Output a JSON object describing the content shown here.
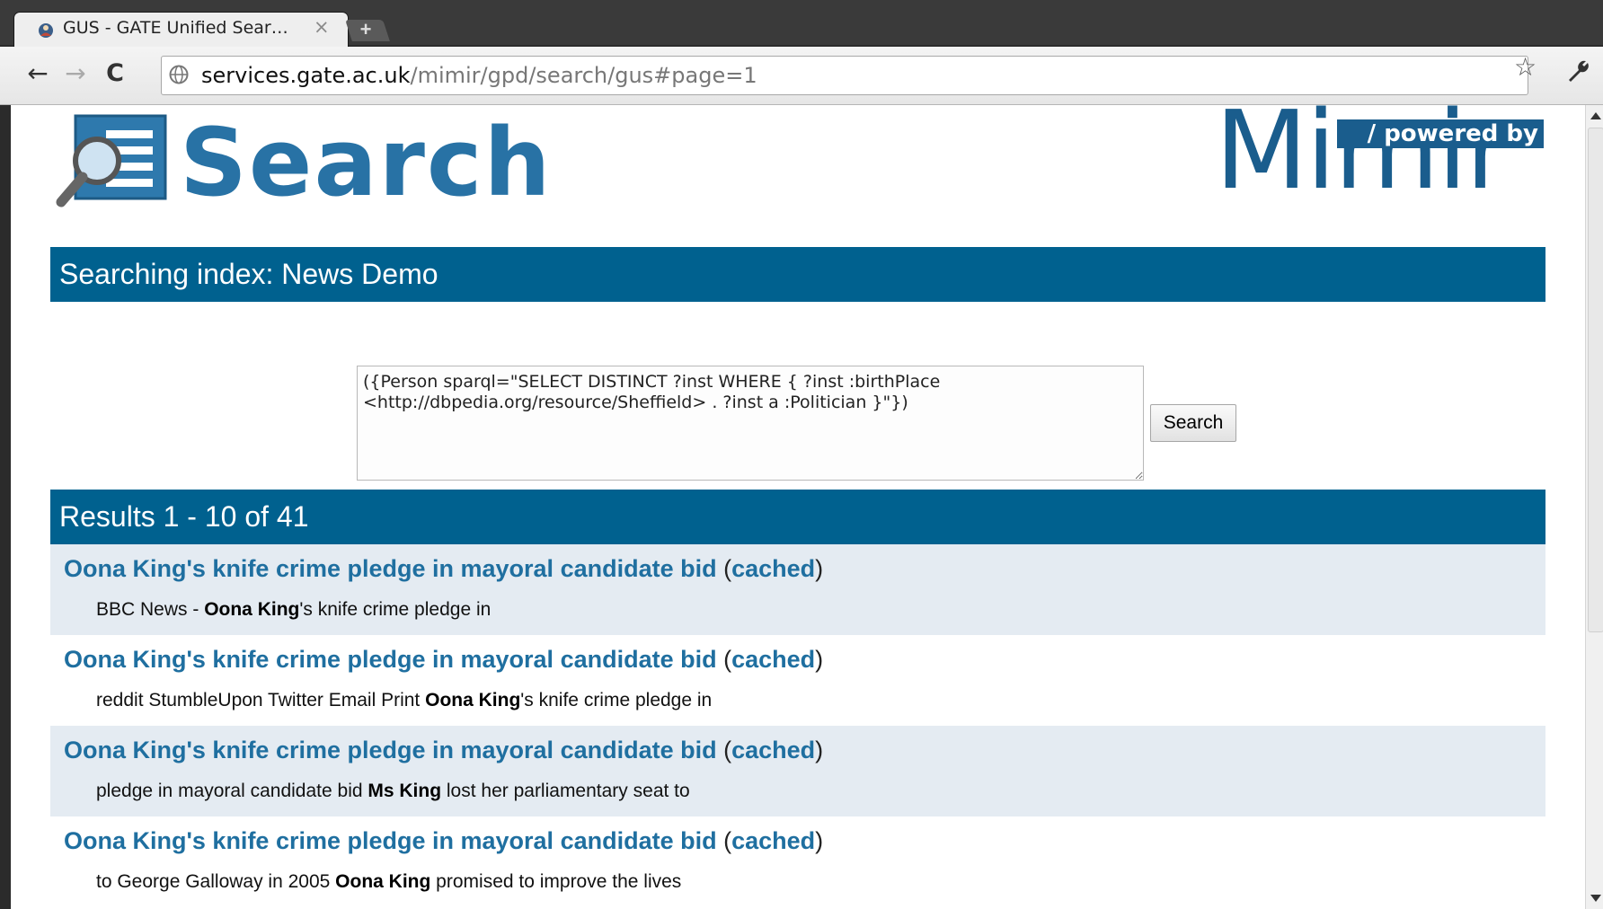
{
  "browser": {
    "tab_title": "GUS - GATE Unified Sear…",
    "tab_close": "×",
    "new_tab": "+",
    "back": "←",
    "forward": "→",
    "reload": "C",
    "url_host": "services.gate.ac.uk",
    "url_path": "/mimir/gpd/search/gus#page=1",
    "bookmark_star": "☆"
  },
  "header": {
    "search_logo_text": "Search",
    "mimir_text": "Mimir",
    "powered_by": "/ powered by"
  },
  "index_bar": {
    "label": "Searching index: News Demo"
  },
  "query": {
    "text": "({Person sparql=\"SELECT DISTINCT ?inst WHERE { ?inst :birthPlace <http://dbpedia.org/resource/Sheffield> . ?inst a :Politician }\"})",
    "search_button": "Search"
  },
  "results_bar": {
    "label": "Results 1 - 10 of 41"
  },
  "results": [
    {
      "title": "Oona King's knife crime pledge in mayoral candidate bid",
      "cached": "cached",
      "snippet_pre": "BBC News - ",
      "snippet_bold": "Oona King",
      "snippet_post": "'s knife crime pledge in"
    },
    {
      "title": "Oona King's knife crime pledge in mayoral candidate bid",
      "cached": "cached",
      "snippet_pre": "reddit StumbleUpon Twitter Email Print ",
      "snippet_bold": "Oona King",
      "snippet_post": "'s knife crime pledge in"
    },
    {
      "title": "Oona King's knife crime pledge in mayoral candidate bid",
      "cached": "cached",
      "snippet_pre": "pledge in mayoral candidate bid ",
      "snippet_bold": "Ms King",
      "snippet_post": " lost her parliamentary seat to"
    },
    {
      "title": "Oona King's knife crime pledge in mayoral candidate bid",
      "cached": "cached",
      "snippet_pre": "to George Galloway in 2005 ",
      "snippet_bold": "Oona King",
      "snippet_post": " promised to improve the lives"
    }
  ],
  "colors": {
    "bar_blue": "#00618f",
    "link_blue": "#1f6fa0",
    "logo_blue": "#2872a5",
    "mimir_blue": "#1a5d8d",
    "result_shade": "#e4ebf2"
  },
  "icons": [
    "gus-favicon-icon",
    "globe-icon",
    "wrench-icon",
    "search-logo-icon",
    "star-icon"
  ]
}
